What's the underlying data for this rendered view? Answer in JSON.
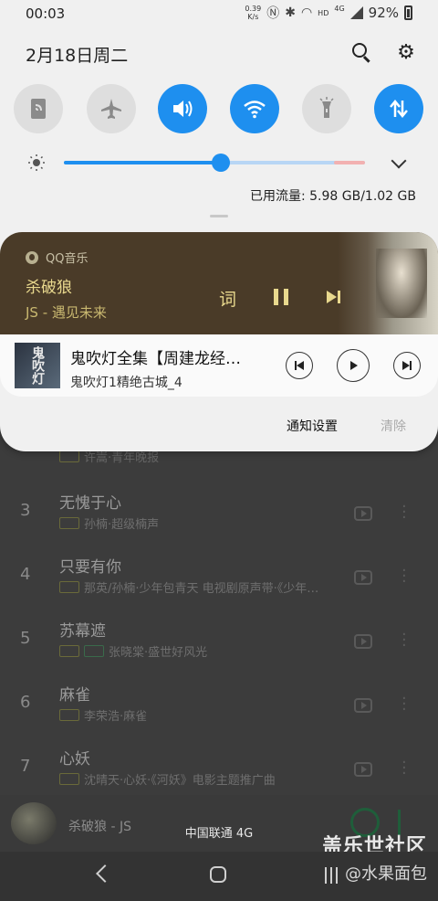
{
  "status_bar": {
    "time": "00:03",
    "speed_value": "0.39",
    "speed_unit": "K/s",
    "net_label": "4G",
    "hd_label": "HD",
    "battery": "92%"
  },
  "header": {
    "date": "2月18日周二"
  },
  "quick_settings": [
    {
      "name": "nfc",
      "state": "off"
    },
    {
      "name": "airplane",
      "state": "off"
    },
    {
      "name": "sound",
      "state": "on"
    },
    {
      "name": "wifi",
      "state": "on"
    },
    {
      "name": "flashlight",
      "state": "off"
    },
    {
      "name": "mobile-data",
      "state": "on"
    }
  ],
  "brightness": {
    "level": 0.52
  },
  "data_usage": "已用流量: 5.98 GB/1.02 GB",
  "qq_music": {
    "app_name": "QQ音乐",
    "title": "杀破狼",
    "artist": "JS - 遇见未来",
    "lyric_label": "词",
    "bg_color": "#4a3b28",
    "text_color": "#e9d98e"
  },
  "podcast": {
    "art_label": "鬼吹灯",
    "title": "鬼吹灯全集【周建龙经…",
    "subtitle": "鬼吹灯1精绝古城_4"
  },
  "notification_actions": {
    "settings": "通知设置",
    "clear": "清除"
  },
  "background_list": {
    "top_partial_sub": "许嵩·青年晚报",
    "rows": [
      {
        "num": "3",
        "title": "无愧于心",
        "sub": "孙楠·超级楠声"
      },
      {
        "num": "4",
        "title": "只要有你",
        "sub": "那英/孙楠·少年包青天 电视剧原声带·《少年…"
      },
      {
        "num": "5",
        "title": "苏幕遮",
        "sub": "张晓棠·盛世好风光"
      },
      {
        "num": "6",
        "title": "麻雀",
        "sub": "李荣浩·麻雀"
      },
      {
        "num": "7",
        "title": "心妖",
        "sub": "沈晴天·心妖·《河妖》电影主题推广曲"
      }
    ]
  },
  "mini_player": {
    "title": "杀破狼 - JS"
  },
  "carrier": "中国联通 4G",
  "watermark": {
    "line1": "盖乐世社区",
    "line2": "@水果面包"
  }
}
